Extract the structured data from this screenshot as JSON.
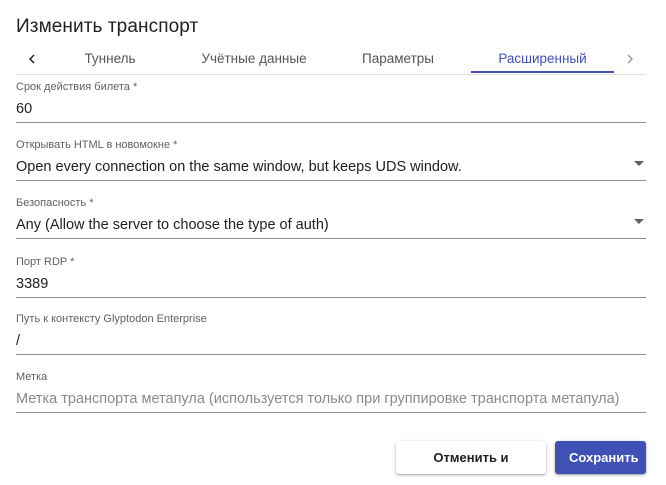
{
  "dialog": {
    "title": "Изменить транспорт"
  },
  "tabs": {
    "items": [
      {
        "label": "Туннель"
      },
      {
        "label": "Учётные данные"
      },
      {
        "label": "Параметры"
      },
      {
        "label": "Расширенный",
        "active": true
      }
    ],
    "left_icon": "chevron-left-icon",
    "right_icon": "chevron-right-icon"
  },
  "fields": {
    "ticket_validity": {
      "label": "Срок действия билета *",
      "value": "60"
    },
    "open_html_window": {
      "label": "Открывать HTML в новомокне *",
      "value": "Open every connection on the same window, but keeps UDS window."
    },
    "security": {
      "label": "Безопасность *",
      "value": "Any (Allow the server to choose the type of auth)"
    },
    "rdp_port": {
      "label": "Порт RDP *",
      "value": "3389"
    },
    "context_path": {
      "label": "Путь к контексту Glyptodon Enterprise",
      "value": "/"
    },
    "label": {
      "label": "Метка",
      "placeholder": "Метка транспорта метапула (используется только при группировке транспорта метапула)"
    }
  },
  "actions": {
    "cancel_label": "Отменить и закрыть",
    "save_label": "Сохранить"
  },
  "colors": {
    "accent": "#3f51b5"
  }
}
